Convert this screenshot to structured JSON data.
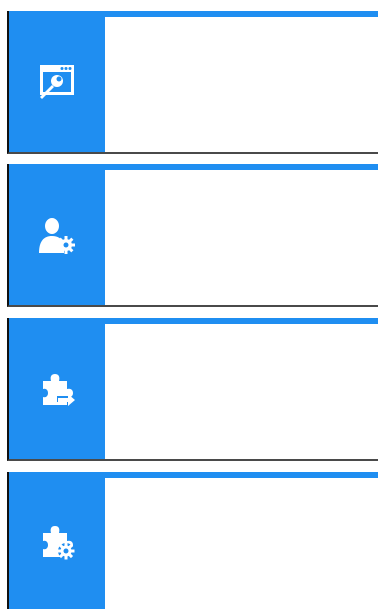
{
  "tiles": [
    {
      "icon": "window-wrench-icon",
      "label": ""
    },
    {
      "icon": "user-gear-icon",
      "label": ""
    },
    {
      "icon": "plugin-arrow-icon",
      "label": ""
    },
    {
      "icon": "plugin-gear-icon",
      "label": ""
    }
  ],
  "colors": {
    "accent": "#1f8ef1",
    "panel": "#ffffff"
  }
}
